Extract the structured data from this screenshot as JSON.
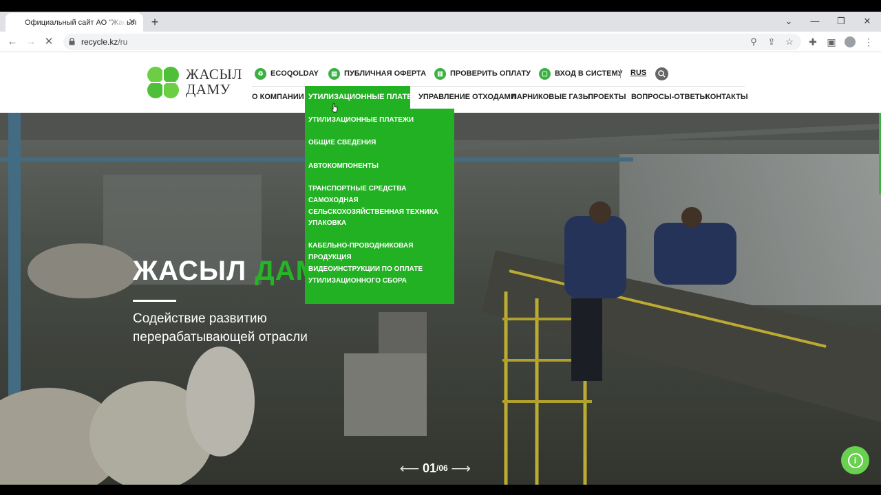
{
  "browser": {
    "tab_title": "Официальный сайт АО \"Жасыл",
    "url_host": "recycle.kz",
    "url_path": "/ru"
  },
  "logo": {
    "line1": "ЖАСЫЛ",
    "line2": "ДАМУ"
  },
  "top_nav": [
    {
      "label": "ECOQOLDAY",
      "icon": "recycle-icon"
    },
    {
      "label": "ПУБЛИЧНАЯ ОФЕРТА",
      "icon": "document-icon"
    },
    {
      "label": "ПРОВЕРИТЬ ОПЛАТУ",
      "icon": "receipt-icon"
    },
    {
      "label": "ВХОД В СИСТЕМУ",
      "icon": "lock-icon"
    }
  ],
  "language": "RUS",
  "main_nav": {
    "about": "О КОМПАНИИ",
    "payments": "УТИЛИЗАЦИОННЫЕ ПЛАТЕЖИ",
    "waste": "УПРАВЛЕНИЕ ОТХОДАМИ",
    "ghg": "ПАРНИКОВЫЕ ГАЗЫ",
    "projects": "ПРОЕКТЫ",
    "faq": "ВОПРОСЫ-ОТВЕТЫ",
    "contacts": "КОНТАКТЫ"
  },
  "dropdown": [
    "УТИЛИЗАЦИОННЫЕ ПЛАТЕЖИ",
    "ОБЩИЕ СВЕДЕНИЯ",
    "АВТОКОМПОНЕНТЫ",
    "ТРАНСПОРТНЫЕ СРЕДСТВА САМОХОДНАЯ СЕЛЬСКОХОЗЯЙСТВЕННАЯ ТЕХНИКА",
    "УПАКОВКА",
    "КАБЕЛЬНО-ПРОВОДНИКОВАЯ ПРОДУКЦИЯ",
    "ВИДЕОИНСТРУКЦИИ ПО ОПЛАТЕ УТИЛИЗАЦИОННОГО СБОРА"
  ],
  "hero": {
    "title_white": "ЖАСЫЛ",
    "title_green": "ДАМУ",
    "subtitle": "Содействие развитию перерабатывающей отрасли",
    "slide_current": "01",
    "slide_total": "/06"
  },
  "colors": {
    "brand_green": "#22b123",
    "logo_green": "#6ccf43"
  }
}
